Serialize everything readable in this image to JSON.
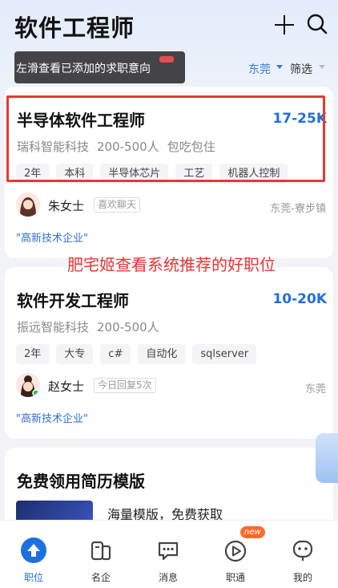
{
  "header": {
    "title": "软件工程师",
    "tooltip": "左滑查看已添加的求职意向",
    "city": "东莞",
    "filter": "筛选"
  },
  "jobs": [
    {
      "title": "半导体软件工程师",
      "salary": "17-25K",
      "company": "瑞科智能科技",
      "size": "200-500人",
      "perk": "包吃包住",
      "tags": [
        "2年",
        "本科",
        "半导体芯片",
        "工艺",
        "机器人控制"
      ],
      "recruiter": "朱女士",
      "recruiter_badge": "喜欢聊天",
      "location": "东莞-寮步镇",
      "qualification": "\"高新技术企业\""
    },
    {
      "title": "软件开发工程师",
      "salary": "10-20K",
      "company": "振远智能科技",
      "size": "200-500人",
      "tags": [
        "2年",
        "大专",
        "c#",
        "自动化",
        "sqlserver"
      ],
      "recruiter": "赵女士",
      "recruiter_badge": "今日回复5次",
      "location": "东莞",
      "qualification": "\"高新技术企业\""
    }
  ],
  "annotation": "肥宅姬查看系统推荐的好职位",
  "promo": {
    "title": "免费领用简历模版",
    "subtitle": "海量模版，免费获取"
  },
  "tabbar": {
    "items": [
      {
        "label": "职位",
        "icon": "job-icon",
        "active": true
      },
      {
        "label": "名企",
        "icon": "company-icon"
      },
      {
        "label": "消息",
        "icon": "message-icon"
      },
      {
        "label": "职通",
        "icon": "play-icon",
        "badge": "new"
      },
      {
        "label": "我的",
        "icon": "profile-icon"
      }
    ]
  },
  "colors": {
    "accent": "#1e6fe0",
    "highlight": "#e53935"
  }
}
